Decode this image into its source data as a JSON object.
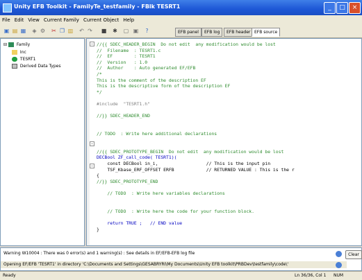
{
  "window": {
    "title": "Unity EFB Toolkit - FamilyTe_testfamily - FBlk TESRT1"
  },
  "menu": [
    "File",
    "Edit",
    "View",
    "Current Family",
    "Current Object",
    "Help"
  ],
  "tabs": [
    "EFB panel",
    "EFB log",
    "EFB header",
    "EFB source"
  ],
  "tree": {
    "root": "Family",
    "children": [
      "Inc",
      "TESRT1",
      "Derived Data Types"
    ]
  },
  "code": [
    {
      "t": "cmt",
      "s": "//{{ SDEC_HEADER_BEGIN  Do not edit  any modification would be lost"
    },
    {
      "t": "cmt",
      "s": "//  Filename  : TESRT1.c"
    },
    {
      "t": "cmt",
      "s": "//  EF        : TESRT1"
    },
    {
      "t": "cmt",
      "s": "//  Version   : 1.0"
    },
    {
      "t": "cmt",
      "s": "//  Author    : Auto generated EF/EFB"
    },
    {
      "t": "cmt",
      "s": "/*"
    },
    {
      "t": "cmt",
      "s": "This is the comment of the description EF"
    },
    {
      "t": "cmt",
      "s": "This is the descriptive form of the description EF"
    },
    {
      "t": "cmt",
      "s": "*/"
    },
    {
      "t": "blank",
      "s": ""
    },
    {
      "t": "pp",
      "s": "#include  \"TESRT1.h\""
    },
    {
      "t": "blank",
      "s": ""
    },
    {
      "t": "cmt",
      "s": "//}} SDEC_HEADER_END"
    },
    {
      "t": "blank",
      "s": ""
    },
    {
      "t": "blank",
      "s": ""
    },
    {
      "t": "cmt",
      "s": "// TODO  : Write here additional declarations"
    },
    {
      "t": "blank",
      "s": ""
    },
    {
      "t": "blank",
      "s": ""
    },
    {
      "t": "cmt",
      "s": "//{{ SDEC_PROTOTYPE_BEGIN  Do not edit  any modification would be lost"
    },
    {
      "t": "kw",
      "s": "DECBool ZF_call_code( TESRT1)("
    },
    {
      "t": "code",
      "s": "    const DECBool in_i,                  // This is the input pin"
    },
    {
      "t": "code",
      "s": "    TSF_Kbase_ERF_OFFSET ERFB            // RETURNED VALUE : This is the r"
    },
    {
      "t": "code",
      "s": "{"
    },
    {
      "t": "cmt",
      "s": "//}} SDEC_PROTOTYPE_END"
    },
    {
      "t": "blank",
      "s": ""
    },
    {
      "t": "cmt",
      "s": "    // TODO  : Write here variables declarations"
    },
    {
      "t": "blank",
      "s": ""
    },
    {
      "t": "blank",
      "s": ""
    },
    {
      "t": "cmt",
      "s": "    // TODO  : Write here the code for your function block."
    },
    {
      "t": "blank",
      "s": ""
    },
    {
      "t": "kw",
      "s": "    return TRUE ;   // END value"
    },
    {
      "t": "code",
      "s": "}"
    }
  ],
  "output": {
    "line1": "Warning W10004 : There was 0 error(s) and 1 warning(s) : See details in EF/EFB-EFB log file",
    "line2": "Opening EF/EFB 'TESRT1' in directory 'C:\\Documents and Settings\\GESABRYRI\\My Documents\\Unity EFB toolkit\\PRBDev\\testfamily\\code\\'",
    "clear_label": "Clear"
  },
  "status": {
    "left": "Ready",
    "position": "Ln 36/36, Col 1",
    "mode": "NUM"
  }
}
